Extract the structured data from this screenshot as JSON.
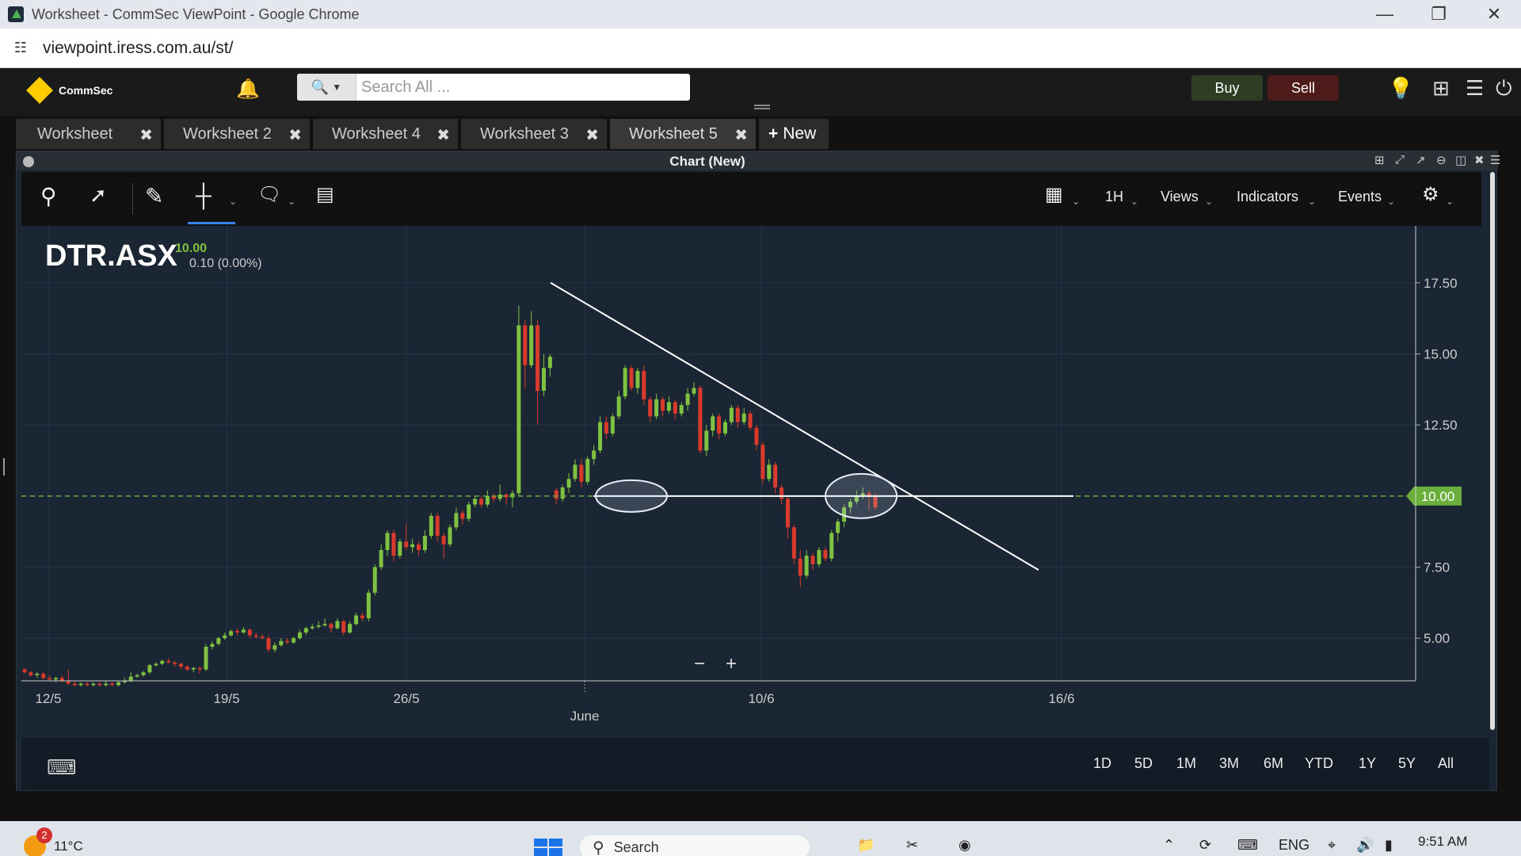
{
  "window": {
    "title": "Worksheet - CommSec ViewPoint - Google Chrome",
    "minimize_icon": "minimize-icon",
    "restore_icon": "restore-icon",
    "close_icon": "close-icon"
  },
  "address": {
    "url": "viewpoint.iress.com.au/st/"
  },
  "header": {
    "logo_text": "CommSec",
    "search_placeholder": "Search All ...",
    "buy_label": "Buy",
    "sell_label": "Sell"
  },
  "tabs": [
    {
      "label": "Worksheet",
      "active": false
    },
    {
      "label": "Worksheet 2",
      "active": false
    },
    {
      "label": "Worksheet 4",
      "active": false
    },
    {
      "label": "Worksheet 3",
      "active": false
    },
    {
      "label": "Worksheet 5",
      "active": true
    }
  ],
  "new_tab_label": "New",
  "panel": {
    "title": "Chart (New)"
  },
  "toolbar": {
    "interval": "1H",
    "views": "Views",
    "indicators": "Indicators",
    "events": "Events"
  },
  "chart_data": {
    "type": "candlestick",
    "symbol": "DTR.ASX",
    "last_price": "10.00",
    "change": "0.10 (0.00%)",
    "price_tag": "10.00",
    "ylim": [
      3.5,
      19.5
    ],
    "yticks": [
      "17.50",
      "15.00",
      "12.50",
      "10.00",
      "7.50",
      "5.00"
    ],
    "ytick_values": [
      17.5,
      15.0,
      12.5,
      10.0,
      7.5,
      5.0
    ],
    "xticks": [
      "12/5",
      "19/5",
      "26/5",
      "10/6",
      "16/6"
    ],
    "xtick_sub": "June",
    "colors": {
      "up": "#7fc241",
      "down": "#d93a2b",
      "tag": "#6aaf3c",
      "background": "#1b2634"
    },
    "annotations": {
      "trendline": "descending line from about 17.5 (late May) to about 7.4 (mid June)",
      "support_line": "horizontal line at 10.00",
      "circles": 2
    },
    "candles": [
      [
        3.9,
        3.8,
        3.95,
        3.75
      ],
      [
        3.8,
        3.7,
        3.85,
        3.65
      ],
      [
        3.7,
        3.75,
        3.8,
        3.6
      ],
      [
        3.75,
        3.6,
        3.8,
        3.55
      ],
      [
        3.6,
        3.55,
        3.7,
        3.5
      ],
      [
        3.55,
        3.6,
        3.65,
        3.45
      ],
      [
        3.6,
        3.5,
        3.7,
        3.45
      ],
      [
        3.5,
        3.4,
        3.9,
        3.35
      ],
      [
        3.4,
        3.35,
        3.5,
        3.3
      ],
      [
        3.35,
        3.4,
        3.45,
        3.3
      ],
      [
        3.4,
        3.35,
        3.45,
        3.3
      ],
      [
        3.35,
        3.4,
        3.45,
        3.3
      ],
      [
        3.4,
        3.35,
        3.45,
        3.3
      ],
      [
        3.35,
        3.4,
        3.5,
        3.3
      ],
      [
        3.4,
        3.35,
        3.45,
        3.3
      ],
      [
        3.35,
        3.45,
        3.5,
        3.3
      ],
      [
        3.45,
        3.5,
        3.6,
        3.4
      ],
      [
        3.5,
        3.65,
        3.8,
        3.45
      ],
      [
        3.65,
        3.7,
        3.75,
        3.6
      ],
      [
        3.7,
        3.8,
        3.85,
        3.65
      ],
      [
        3.8,
        4.05,
        4.1,
        3.75
      ],
      [
        4.05,
        4.1,
        4.15,
        4.0
      ],
      [
        4.1,
        4.2,
        4.25,
        4.05
      ],
      [
        4.2,
        4.15,
        4.3,
        4.1
      ],
      [
        4.15,
        4.1,
        4.2,
        4.0
      ],
      [
        4.1,
        4.0,
        4.15,
        3.9
      ],
      [
        4.0,
        3.9,
        4.05,
        3.85
      ],
      [
        3.9,
        3.95,
        4.0,
        3.8
      ],
      [
        3.95,
        3.9,
        4.0,
        3.75
      ],
      [
        3.9,
        4.7,
        4.8,
        3.85
      ],
      [
        4.7,
        4.8,
        4.9,
        4.6
      ],
      [
        4.8,
        5.0,
        5.05,
        4.75
      ],
      [
        5.0,
        5.1,
        5.2,
        4.95
      ],
      [
        5.1,
        5.25,
        5.3,
        5.05
      ],
      [
        5.25,
        5.2,
        5.35,
        5.1
      ],
      [
        5.2,
        5.3,
        5.4,
        5.15
      ],
      [
        5.3,
        5.1,
        5.35,
        5.0
      ],
      [
        5.1,
        5.05,
        5.2,
        5.0
      ],
      [
        5.05,
        5.0,
        5.15,
        4.95
      ],
      [
        5.0,
        4.6,
        5.1,
        4.5
      ],
      [
        4.6,
        4.75,
        4.85,
        4.5
      ],
      [
        4.75,
        4.9,
        5.0,
        4.7
      ],
      [
        4.9,
        4.85,
        5.0,
        4.8
      ],
      [
        4.85,
        5.0,
        5.05,
        4.8
      ],
      [
        5.0,
        5.2,
        5.3,
        4.95
      ],
      [
        5.2,
        5.35,
        5.4,
        5.1
      ],
      [
        5.35,
        5.4,
        5.5,
        5.3
      ],
      [
        5.4,
        5.45,
        5.6,
        5.35
      ],
      [
        5.45,
        5.5,
        5.7,
        5.4
      ],
      [
        5.5,
        5.35,
        5.55,
        5.2
      ],
      [
        5.35,
        5.6,
        5.7,
        5.3
      ],
      [
        5.6,
        5.2,
        5.65,
        5.1
      ],
      [
        5.2,
        5.5,
        5.6,
        5.15
      ],
      [
        5.5,
        5.8,
        5.9,
        5.45
      ],
      [
        5.8,
        5.7,
        5.9,
        5.6
      ],
      [
        5.7,
        6.6,
        6.7,
        5.6
      ],
      [
        6.6,
        7.5,
        7.6,
        6.5
      ],
      [
        7.5,
        8.1,
        8.3,
        7.4
      ],
      [
        8.1,
        8.7,
        8.8,
        7.9
      ],
      [
        8.7,
        7.9,
        8.8,
        7.7
      ],
      [
        7.9,
        8.4,
        8.5,
        7.8
      ],
      [
        8.4,
        8.2,
        9.0,
        8.1
      ],
      [
        8.2,
        8.3,
        8.5,
        8.0
      ],
      [
        8.3,
        8.1,
        8.4,
        7.9
      ],
      [
        8.1,
        8.6,
        8.8,
        8.0
      ],
      [
        8.6,
        9.3,
        9.4,
        8.5
      ],
      [
        9.3,
        8.6,
        9.4,
        8.4
      ],
      [
        8.6,
        8.3,
        8.7,
        7.8
      ],
      [
        8.3,
        8.9,
        9.0,
        8.2
      ],
      [
        8.9,
        9.4,
        9.6,
        8.8
      ],
      [
        9.4,
        9.2,
        9.5,
        9.0
      ],
      [
        9.2,
        9.7,
        9.8,
        9.1
      ],
      [
        9.7,
        9.9,
        10.0,
        9.6
      ],
      [
        9.9,
        9.7,
        10.0,
        9.6
      ],
      [
        9.7,
        10.0,
        10.2,
        9.6
      ],
      [
        10.0,
        9.9,
        10.1,
        9.8
      ],
      [
        9.9,
        10.05,
        10.4,
        9.8
      ],
      [
        10.05,
        9.95,
        10.1,
        9.7
      ],
      [
        9.95,
        10.1,
        10.2,
        9.6
      ],
      [
        10.1,
        16.0,
        16.7,
        10.0
      ],
      [
        16.0,
        14.6,
        16.2,
        13.8
      ],
      [
        14.6,
        16.0,
        16.5,
        14.5
      ],
      [
        16.0,
        13.7,
        16.2,
        12.5
      ],
      [
        13.7,
        14.5,
        15.0,
        13.5
      ],
      [
        14.5,
        14.9,
        15.0,
        14.2
      ],
      [
        10.2,
        9.9,
        10.3,
        9.7
      ],
      [
        9.9,
        10.3,
        10.4,
        9.8
      ],
      [
        10.3,
        10.6,
        10.8,
        10.1
      ],
      [
        10.6,
        11.1,
        11.3,
        10.5
      ],
      [
        11.1,
        10.5,
        11.3,
        10.3
      ],
      [
        10.5,
        11.3,
        11.4,
        10.4
      ],
      [
        11.3,
        11.6,
        11.8,
        11.1
      ],
      [
        11.6,
        12.6,
        12.8,
        11.5
      ],
      [
        12.6,
        12.2,
        12.8,
        12.0
      ],
      [
        12.2,
        12.8,
        12.9,
        12.1
      ],
      [
        12.8,
        13.5,
        13.7,
        12.7
      ],
      [
        13.5,
        14.5,
        14.6,
        13.4
      ],
      [
        14.5,
        13.8,
        14.6,
        13.7
      ],
      [
        13.8,
        14.4,
        14.5,
        13.6
      ],
      [
        14.4,
        13.4,
        14.6,
        13.2
      ],
      [
        13.4,
        12.8,
        13.5,
        12.6
      ],
      [
        12.8,
        13.4,
        13.6,
        12.7
      ],
      [
        13.4,
        13.0,
        13.5,
        12.8
      ],
      [
        13.0,
        13.3,
        13.5,
        12.9
      ],
      [
        13.3,
        12.9,
        13.4,
        12.7
      ],
      [
        12.9,
        13.2,
        13.3,
        12.8
      ],
      [
        13.2,
        13.6,
        13.8,
        13.0
      ],
      [
        13.6,
        13.8,
        14.0,
        13.5
      ],
      [
        13.8,
        11.6,
        13.9,
        11.5
      ],
      [
        11.6,
        12.3,
        12.5,
        11.4
      ],
      [
        12.3,
        12.8,
        12.9,
        12.1
      ],
      [
        12.8,
        12.2,
        12.9,
        12.0
      ],
      [
        12.2,
        12.6,
        12.7,
        12.1
      ],
      [
        12.6,
        13.1,
        13.2,
        12.5
      ],
      [
        13.1,
        12.6,
        13.2,
        12.4
      ],
      [
        12.6,
        12.9,
        13.1,
        12.5
      ],
      [
        12.9,
        12.4,
        13.0,
        12.3
      ],
      [
        12.4,
        11.8,
        12.5,
        11.6
      ],
      [
        11.8,
        10.6,
        11.9,
        10.4
      ],
      [
        10.6,
        11.1,
        11.3,
        10.5
      ],
      [
        11.1,
        10.3,
        11.2,
        10.1
      ],
      [
        10.3,
        9.9,
        10.4,
        9.7
      ],
      [
        9.9,
        8.9,
        10.0,
        8.5
      ],
      [
        8.9,
        7.8,
        9.0,
        7.6
      ],
      [
        7.8,
        7.2,
        8.1,
        6.8
      ],
      [
        7.2,
        7.9,
        8.1,
        7.1
      ],
      [
        7.9,
        7.6,
        8.0,
        7.4
      ],
      [
        7.6,
        8.1,
        8.2,
        7.5
      ],
      [
        8.1,
        7.8,
        8.2,
        7.7
      ],
      [
        7.8,
        8.7,
        8.8,
        7.7
      ],
      [
        8.7,
        9.1,
        9.2,
        8.4
      ],
      [
        9.1,
        9.6,
        9.7,
        8.9
      ],
      [
        9.6,
        9.8,
        9.9,
        9.4
      ],
      [
        9.8,
        10.0,
        10.2,
        9.7
      ],
      [
        10.0,
        10.1,
        10.3,
        9.9
      ],
      [
        10.1,
        10.0,
        10.2,
        9.5
      ],
      [
        10.0,
        9.6,
        10.1,
        9.5
      ]
    ]
  },
  "range_buttons": [
    "1D",
    "5D",
    "1M",
    "3M",
    "6M",
    "YTD",
    "1Y",
    "5Y",
    "All"
  ],
  "taskbar": {
    "badge_count": "2",
    "temperature": "11°C",
    "search_label": "Search",
    "language": "ENG",
    "time": "9:51 AM"
  }
}
